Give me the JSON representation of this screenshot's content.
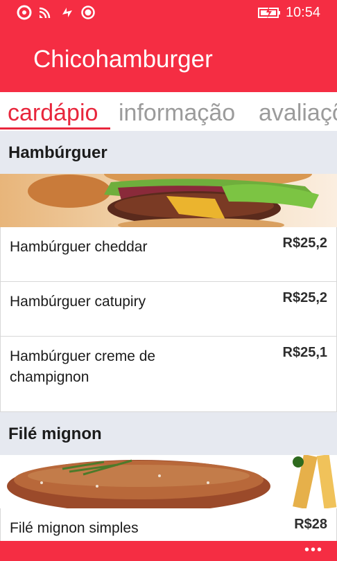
{
  "status_bar": {
    "time": "10:54",
    "icons": [
      "signal-icon",
      "wifi-icon",
      "data-sync-icon",
      "location-icon",
      "battery-charging-icon"
    ]
  },
  "app": {
    "title": "Chicohamburger",
    "accent_color": "#f52d43"
  },
  "pivot": {
    "tabs": [
      {
        "label": "cardápio",
        "active": true
      },
      {
        "label": "informação",
        "active": false
      },
      {
        "label": "avaliaçõ",
        "active": false
      }
    ]
  },
  "menu": {
    "sections": [
      {
        "title": "Hambúrguer",
        "items": [
          {
            "name": "Hambúrguer cheddar",
            "price": "R$25,2"
          },
          {
            "name": "Hambúrguer catupiry",
            "price": "R$25,2"
          },
          {
            "name": "Hambúrguer creme de champignon",
            "price": "R$25,1"
          }
        ]
      },
      {
        "title": "Filé mignon",
        "items": [
          {
            "name": "Filé mignon simples",
            "price": "R$28"
          }
        ]
      }
    ]
  },
  "app_bar": {
    "more_label": "•••"
  }
}
